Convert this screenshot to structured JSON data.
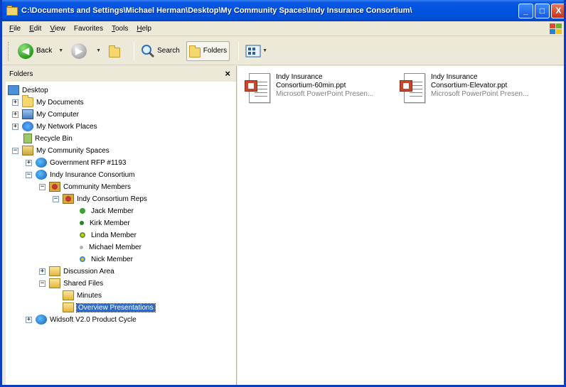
{
  "window": {
    "title": "C:\\Documents and Settings\\Michael Herman\\Desktop\\My Community Spaces\\Indy Insurance Consortium\\",
    "controls": [
      "_",
      "□",
      "X"
    ]
  },
  "menu": [
    {
      "u": "F",
      "rest": "ile"
    },
    {
      "u": "E",
      "rest": "dit"
    },
    {
      "u": "V",
      "rest": "iew"
    },
    {
      "u": "",
      "rest": "Favorites",
      "u_index": 1
    },
    {
      "u": "T",
      "rest": "ools"
    },
    {
      "u": "H",
      "rest": "elp"
    }
  ],
  "toolbar": {
    "back_label": "Back",
    "search_label": "Search",
    "folders_label": "Folders"
  },
  "folders_pane": {
    "header": "Folders",
    "close": "×"
  },
  "tree": {
    "desktop": "Desktop",
    "my_documents": "My Documents",
    "my_computer": "My Computer",
    "my_network_places": "My Network Places",
    "recycle_bin": "Recycle Bin",
    "my_community_spaces": "My Community Spaces",
    "government_rfp": "Government RFP #1193",
    "indy_insurance": "Indy Insurance Consortium",
    "community_members": "Community Members",
    "indy_reps": "Indy Consortium Reps",
    "members": [
      "Jack Member",
      "Kirk Member",
      "Linda Member",
      "Michael Member",
      "Nick Member"
    ],
    "discussion_area": "Discussion Area",
    "shared_files": "Shared Files",
    "minutes": "Minutes",
    "overview_presentations": "Overview Presentations",
    "widsoft": "Widsoft V2.0 Product Cycle"
  },
  "files": [
    {
      "line1": "Indy Insurance",
      "line2": "Consortium-60min.ppt",
      "line3": "Microsoft PowerPoint Presen..."
    },
    {
      "line1": "Indy Insurance",
      "line2": "Consortium-Elevator.ppt",
      "line3": "Microsoft PowerPoint Presen..."
    }
  ],
  "colors": {
    "title_bar": "#0053e0",
    "selection": "#316ac5",
    "ppt_badge": "#c8462b"
  }
}
